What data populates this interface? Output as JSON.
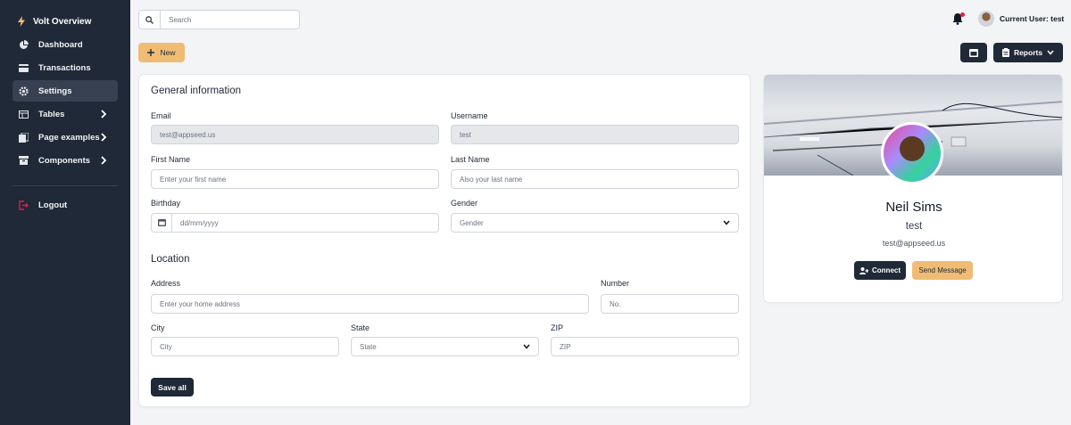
{
  "brand": {
    "title": "Volt Overview"
  },
  "sidebar": {
    "items": [
      {
        "label": "Dashboard",
        "icon": "pie-chart-icon"
      },
      {
        "label": "Transactions",
        "icon": "credit-card-icon"
      },
      {
        "label": "Settings",
        "icon": "gear-icon",
        "active": true
      },
      {
        "label": "Tables",
        "icon": "table-icon",
        "has_submenu": true
      },
      {
        "label": "Page examples",
        "icon": "pages-icon",
        "has_submenu": true
      },
      {
        "label": "Components",
        "icon": "archive-icon",
        "has_submenu": true
      },
      {
        "label": "Logout",
        "icon": "logout-icon"
      }
    ]
  },
  "search": {
    "placeholder": "Search"
  },
  "header": {
    "user_label": "Current User: test"
  },
  "toolbar": {
    "new_label": "New",
    "reports_label": "Reports"
  },
  "form": {
    "general_title": "General information",
    "email": {
      "label": "Email",
      "value": "test@appseed.us"
    },
    "username": {
      "label": "Username",
      "value": "test"
    },
    "first_name": {
      "label": "First Name",
      "placeholder": "Enter your first name"
    },
    "last_name": {
      "label": "Last Name",
      "placeholder": "Also your last name"
    },
    "birthday": {
      "label": "Birthday",
      "placeholder": "dd/mm/yyyy"
    },
    "gender": {
      "label": "Gender",
      "selected": "Gender"
    },
    "location_title": "Location",
    "address": {
      "label": "Address",
      "placeholder": "Enter your home address"
    },
    "number": {
      "label": "Number",
      "placeholder": "No."
    },
    "city": {
      "label": "City",
      "placeholder": "City"
    },
    "state": {
      "label": "State",
      "selected": "State"
    },
    "zip": {
      "label": "ZIP",
      "placeholder": "ZIP"
    },
    "save_label": "Save all"
  },
  "profile": {
    "name": "Neil Sims",
    "username": "test",
    "email": "test@appseed.us",
    "connect_label": "Connect",
    "message_label": "Send Message"
  },
  "colors": {
    "sidebar": "#1f2937",
    "accent": "#f0bc74",
    "dark_button": "#1f2937",
    "notification": "#e11d48"
  }
}
